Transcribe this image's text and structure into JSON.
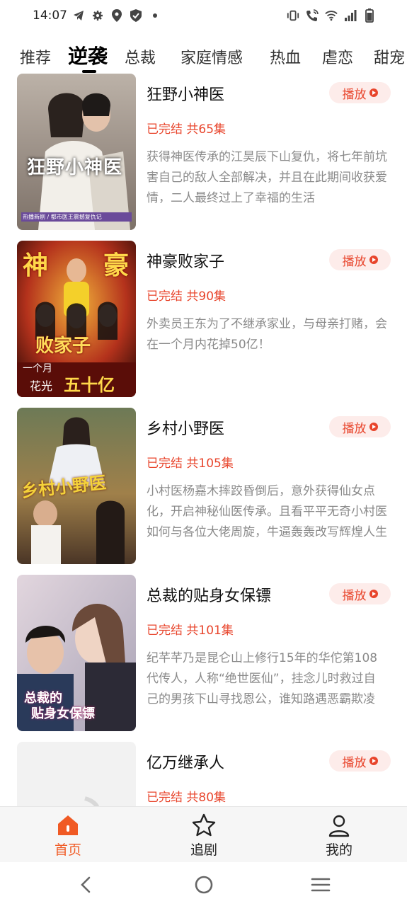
{
  "status_bar": {
    "time": "14:07",
    "left_icons": [
      "telegram-icon",
      "gear-icon",
      "location-icon",
      "shield-icon",
      "dot-icon"
    ],
    "right_icons": [
      "vibrate-icon",
      "wifi-call-icon",
      "wifi-icon",
      "signal-icon",
      "battery-icon"
    ]
  },
  "tabs": [
    {
      "label": "推荐",
      "active": false
    },
    {
      "label": "逆袭",
      "active": true
    },
    {
      "label": "总裁",
      "active": false
    },
    {
      "label": "家庭情感",
      "active": false
    },
    {
      "label": "热血",
      "active": false
    },
    {
      "label": "虐恋",
      "active": false
    },
    {
      "label": "甜宠",
      "active": false
    }
  ],
  "play_label": "播放",
  "items": [
    {
      "title": "狂野小神医",
      "status": "已完结 共65集",
      "description": "获得神医传承的江昊辰下山复仇，将七年前坑害自己的敌人全部解决，并且在此期间收获爱情，二人最终过上了幸福的生活",
      "poster_text": "狂野小神医",
      "poster_caption": "热播新剧 / 都市医王震撼复仇记"
    },
    {
      "title": "神豪败家子",
      "status": "已完结 共90集",
      "description": "外卖员王东为了不继承家业，与母亲打赌，会在一个月内花掉50亿！",
      "poster_text_top_left": "神",
      "poster_text_top_right": "豪",
      "poster_text_mid": "败家子",
      "poster_text_bottom1": "一个月",
      "poster_text_bottom2": "花光",
      "poster_text_bottom3": "五十亿"
    },
    {
      "title": "乡村小野医",
      "status": "已完结 共105集",
      "description": "小村医杨嘉木摔跤昏倒后，意外获得仙女点化，开启神秘仙医传承。且看平平无奇小村医如何与各位大佬周旋，牛逼轰轰改写辉煌人生",
      "poster_text": "乡村小野医"
    },
    {
      "title": "总裁的贴身女保镖",
      "status": "已完结 共101集",
      "description": "纪芊芊乃是昆仑山上修行15年的华佗第108代传人，人称“绝世医仙”，挂念儿时救过自己的男孩下山寻找恩公，谁知路遇恶霸欺凌",
      "poster_text1": "总裁的",
      "poster_text2": "贴身女保镖"
    },
    {
      "title": "亿万继承人",
      "status": "已完结 共80集",
      "description": ""
    }
  ],
  "bottom_nav": [
    {
      "label": "首页",
      "icon": "home-icon",
      "active": true
    },
    {
      "label": "追剧",
      "icon": "star-icon",
      "active": false
    },
    {
      "label": "我的",
      "icon": "user-icon",
      "active": false
    }
  ],
  "system_nav": [
    "back-icon",
    "home-circle-icon",
    "menu-icon"
  ],
  "colors": {
    "accent": "#e8452c",
    "nav_active": "#f05a24",
    "play_bg": "#fdecea"
  }
}
